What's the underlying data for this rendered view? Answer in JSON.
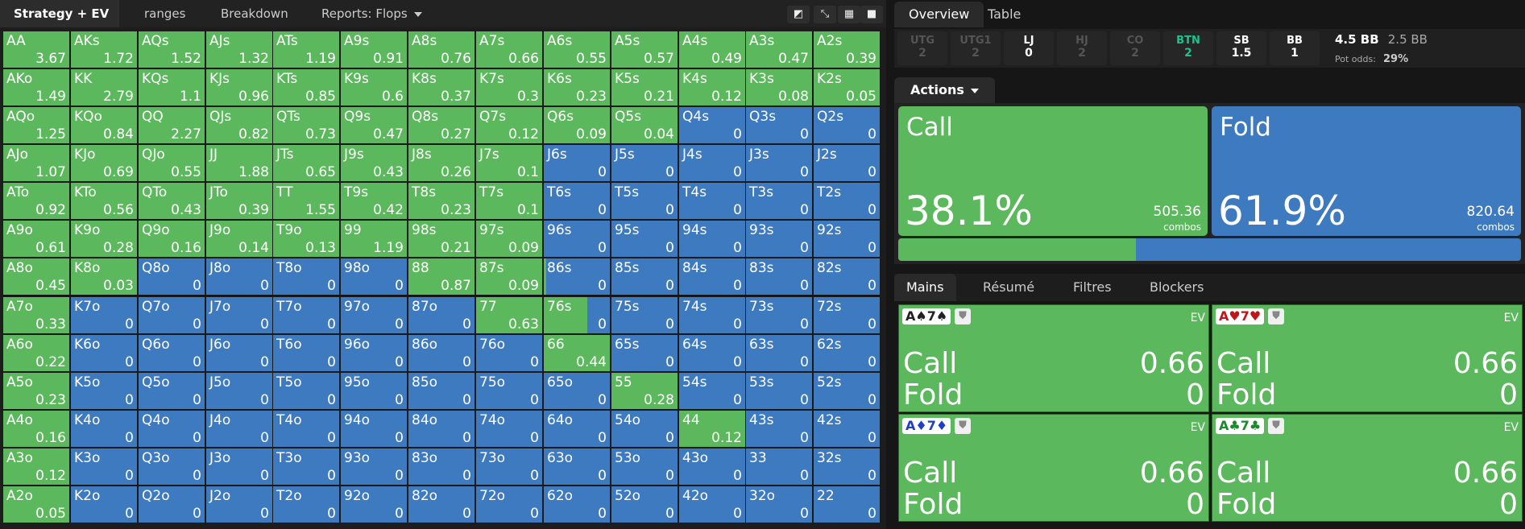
{
  "toolbar": {
    "tab_strategy": "Strategy + EV",
    "tab_ranges": "ranges",
    "tab_breakdown": "Breakdown",
    "tab_reports": "Reports: Flops",
    "btn1_icon": "contrast-icon",
    "btn2_icon": "compress-icon",
    "btn3_icon": "grid-icon",
    "btn4_icon": "square-icon"
  },
  "colors": {
    "call": "#5cb85c",
    "fold": "#3d7abf",
    "btn": "#1dc48c"
  },
  "grid": [
    [
      [
        "AA",
        "3.67",
        1
      ],
      [
        "AKs",
        "1.72",
        1
      ],
      [
        "AQs",
        "1.52",
        1
      ],
      [
        "AJs",
        "1.32",
        1
      ],
      [
        "ATs",
        "1.19",
        1
      ],
      [
        "A9s",
        "0.91",
        1
      ],
      [
        "A8s",
        "0.76",
        1
      ],
      [
        "A7s",
        "0.66",
        1
      ],
      [
        "A6s",
        "0.55",
        1
      ],
      [
        "A5s",
        "0.57",
        1
      ],
      [
        "A4s",
        "0.49",
        1
      ],
      [
        "A3s",
        "0.47",
        1
      ],
      [
        "A2s",
        "0.39",
        1
      ]
    ],
    [
      [
        "AKo",
        "1.49",
        1
      ],
      [
        "KK",
        "2.79",
        1
      ],
      [
        "KQs",
        "1.1",
        1
      ],
      [
        "KJs",
        "0.96",
        1
      ],
      [
        "KTs",
        "0.85",
        1
      ],
      [
        "K9s",
        "0.6",
        1
      ],
      [
        "K8s",
        "0.37",
        1
      ],
      [
        "K7s",
        "0.3",
        1
      ],
      [
        "K6s",
        "0.23",
        1
      ],
      [
        "K5s",
        "0.21",
        1
      ],
      [
        "K4s",
        "0.12",
        1
      ],
      [
        "K3s",
        "0.08",
        1
      ],
      [
        "K2s",
        "0.05",
        1
      ]
    ],
    [
      [
        "AQo",
        "1.25",
        1
      ],
      [
        "KQo",
        "0.84",
        1
      ],
      [
        "QQ",
        "2.27",
        1
      ],
      [
        "QJs",
        "0.82",
        1
      ],
      [
        "QTs",
        "0.73",
        1
      ],
      [
        "Q9s",
        "0.47",
        1
      ],
      [
        "Q8s",
        "0.27",
        1
      ],
      [
        "Q7s",
        "0.12",
        1
      ],
      [
        "Q6s",
        "0.09",
        1
      ],
      [
        "Q5s",
        "0.04",
        1
      ],
      [
        "Q4s",
        "0",
        0
      ],
      [
        "Q3s",
        "0",
        0
      ],
      [
        "Q2s",
        "0",
        0
      ]
    ],
    [
      [
        "AJo",
        "1.07",
        1
      ],
      [
        "KJo",
        "0.69",
        1
      ],
      [
        "QJo",
        "0.55",
        1
      ],
      [
        "JJ",
        "1.88",
        1
      ],
      [
        "JTs",
        "0.65",
        1
      ],
      [
        "J9s",
        "0.43",
        1
      ],
      [
        "J8s",
        "0.26",
        1
      ],
      [
        "J7s",
        "0.1",
        1
      ],
      [
        "J6s",
        "0",
        0
      ],
      [
        "J5s",
        "0",
        0
      ],
      [
        "J4s",
        "0",
        0
      ],
      [
        "J3s",
        "0",
        0
      ],
      [
        "J2s",
        "0",
        0
      ]
    ],
    [
      [
        "ATo",
        "0.92",
        1
      ],
      [
        "KTo",
        "0.56",
        1
      ],
      [
        "QTo",
        "0.43",
        1
      ],
      [
        "JTo",
        "0.39",
        1
      ],
      [
        "TT",
        "1.55",
        1
      ],
      [
        "T9s",
        "0.42",
        1
      ],
      [
        "T8s",
        "0.23",
        1
      ],
      [
        "T7s",
        "0.1",
        1
      ],
      [
        "T6s",
        "0",
        0
      ],
      [
        "T5s",
        "0",
        0
      ],
      [
        "T4s",
        "0",
        0
      ],
      [
        "T3s",
        "0",
        0
      ],
      [
        "T2s",
        "0",
        0
      ]
    ],
    [
      [
        "A9o",
        "0.61",
        1
      ],
      [
        "K9o",
        "0.28",
        1
      ],
      [
        "Q9o",
        "0.16",
        1
      ],
      [
        "J9o",
        "0.14",
        1
      ],
      [
        "T9o",
        "0.13",
        1
      ],
      [
        "99",
        "1.19",
        1
      ],
      [
        "98s",
        "0.21",
        1
      ],
      [
        "97s",
        "0.09",
        1
      ],
      [
        "96s",
        "0",
        0
      ],
      [
        "95s",
        "0",
        0
      ],
      [
        "94s",
        "0",
        0
      ],
      [
        "93s",
        "0",
        0
      ],
      [
        "92s",
        "0",
        0
      ]
    ],
    [
      [
        "A8o",
        "0.45",
        1
      ],
      [
        "K8o",
        "0.03",
        1
      ],
      [
        "Q8o",
        "0",
        0
      ],
      [
        "J8o",
        "0",
        0
      ],
      [
        "T8o",
        "0",
        0
      ],
      [
        "98o",
        "0",
        0
      ],
      [
        "88",
        "0.87",
        1
      ],
      [
        "87s",
        "0.09",
        1
      ],
      [
        "86s",
        "0",
        0.04
      ],
      [
        "85s",
        "0",
        0
      ],
      [
        "84s",
        "0",
        0
      ],
      [
        "83s",
        "0",
        0
      ],
      [
        "82s",
        "0",
        0
      ]
    ],
    [
      [
        "A7o",
        "0.33",
        1
      ],
      [
        "K7o",
        "0",
        0
      ],
      [
        "Q7o",
        "0",
        0
      ],
      [
        "J7o",
        "0",
        0
      ],
      [
        "T7o",
        "0",
        0
      ],
      [
        "97o",
        "0",
        0
      ],
      [
        "87o",
        "0",
        0
      ],
      [
        "77",
        "0.63",
        1
      ],
      [
        "76s",
        "0",
        0.66
      ],
      [
        "75s",
        "0",
        0
      ],
      [
        "74s",
        "0",
        0
      ],
      [
        "73s",
        "0",
        0
      ],
      [
        "72s",
        "0",
        0
      ]
    ],
    [
      [
        "A6o",
        "0.22",
        1
      ],
      [
        "K6o",
        "0",
        0
      ],
      [
        "Q6o",
        "0",
        0
      ],
      [
        "J6o",
        "0",
        0
      ],
      [
        "T6o",
        "0",
        0
      ],
      [
        "96o",
        "0",
        0
      ],
      [
        "86o",
        "0",
        0
      ],
      [
        "76o",
        "0",
        0
      ],
      [
        "66",
        "0.44",
        1
      ],
      [
        "65s",
        "0",
        0
      ],
      [
        "64s",
        "0",
        0
      ],
      [
        "63s",
        "0",
        0
      ],
      [
        "62s",
        "0",
        0
      ]
    ],
    [
      [
        "A5o",
        "0.23",
        1
      ],
      [
        "K5o",
        "0",
        0
      ],
      [
        "Q5o",
        "0",
        0
      ],
      [
        "J5o",
        "0",
        0
      ],
      [
        "T5o",
        "0",
        0
      ],
      [
        "95o",
        "0",
        0
      ],
      [
        "85o",
        "0",
        0
      ],
      [
        "75o",
        "0",
        0
      ],
      [
        "65o",
        "0",
        0
      ],
      [
        "55",
        "0.28",
        1
      ],
      [
        "54s",
        "0",
        0
      ],
      [
        "53s",
        "0",
        0
      ],
      [
        "52s",
        "0",
        0
      ]
    ],
    [
      [
        "A4o",
        "0.16",
        1
      ],
      [
        "K4o",
        "0",
        0
      ],
      [
        "Q4o",
        "0",
        0
      ],
      [
        "J4o",
        "0",
        0
      ],
      [
        "T4o",
        "0",
        0
      ],
      [
        "94o",
        "0",
        0
      ],
      [
        "84o",
        "0",
        0
      ],
      [
        "74o",
        "0",
        0
      ],
      [
        "64o",
        "0",
        0
      ],
      [
        "54o",
        "0",
        0
      ],
      [
        "44",
        "0.12",
        1
      ],
      [
        "43s",
        "0",
        0
      ],
      [
        "42s",
        "0",
        0
      ]
    ],
    [
      [
        "A3o",
        "0.12",
        1
      ],
      [
        "K3o",
        "0",
        0
      ],
      [
        "Q3o",
        "0",
        0
      ],
      [
        "J3o",
        "0",
        0
      ],
      [
        "T3o",
        "0",
        0
      ],
      [
        "93o",
        "0",
        0
      ],
      [
        "83o",
        "0",
        0
      ],
      [
        "73o",
        "0",
        0
      ],
      [
        "63o",
        "0",
        0
      ],
      [
        "53o",
        "0",
        0
      ],
      [
        "43o",
        "0",
        0
      ],
      [
        "33",
        "0",
        0
      ],
      [
        "32s",
        "0",
        0
      ]
    ],
    [
      [
        "A2o",
        "0.05",
        1
      ],
      [
        "K2o",
        "0",
        0
      ],
      [
        "Q2o",
        "0",
        0
      ],
      [
        "J2o",
        "0",
        0
      ],
      [
        "T2o",
        "0",
        0
      ],
      [
        "92o",
        "0",
        0
      ],
      [
        "82o",
        "0",
        0
      ],
      [
        "72o",
        "0",
        0
      ],
      [
        "62o",
        "0",
        0
      ],
      [
        "52o",
        "0",
        0
      ],
      [
        "42o",
        "0",
        0
      ],
      [
        "32o",
        "0",
        0
      ],
      [
        "22",
        "0",
        0
      ]
    ]
  ],
  "right": {
    "tab_overview": "Overview",
    "tab_table": "Table",
    "positions": [
      {
        "name": "UTG",
        "value": "2",
        "state": "dim"
      },
      {
        "name": "UTG1",
        "value": "2",
        "state": "dim"
      },
      {
        "name": "LJ",
        "value": "0",
        "state": "on"
      },
      {
        "name": "HJ",
        "value": "2",
        "state": "dim"
      },
      {
        "name": "CO",
        "value": "2",
        "state": "dim"
      },
      {
        "name": "BTN",
        "value": "2",
        "state": "btn"
      },
      {
        "name": "SB",
        "value": "1.5",
        "state": "on"
      },
      {
        "name": "BB",
        "value": "1",
        "state": "on"
      }
    ],
    "pot": "4.5 BB",
    "bet": "2.5 BB",
    "pot_odds_label": "Pot odds:",
    "pot_odds": "29%",
    "actions_label": "Actions",
    "call": {
      "name": "Call",
      "pct": "38.1%",
      "combos": "505.36",
      "combos_label": "combos",
      "fraction": 0.381
    },
    "fold": {
      "name": "Fold",
      "pct": "61.9%",
      "combos": "820.64",
      "combos_label": "combos"
    },
    "bottom_tabs": [
      "Mains",
      "Résumé",
      "Filtres",
      "Blockers"
    ],
    "ev_label": "EV",
    "combos": [
      {
        "card1": "A♠",
        "card2": "7♠",
        "color": "#222",
        "call": "0.66",
        "fold": "0"
      },
      {
        "card1": "A♥",
        "card2": "7♥",
        "color": "#c0161a",
        "call": "0.66",
        "fold": "0"
      },
      {
        "card1": "A♦",
        "card2": "7♦",
        "color": "#1f3fc4",
        "call": "0.66",
        "fold": "0"
      },
      {
        "card1": "A♣",
        "card2": "7♣",
        "color": "#1a8a2a",
        "call": "0.66",
        "fold": "0"
      }
    ],
    "call_label": "Call",
    "fold_label": "Fold"
  }
}
